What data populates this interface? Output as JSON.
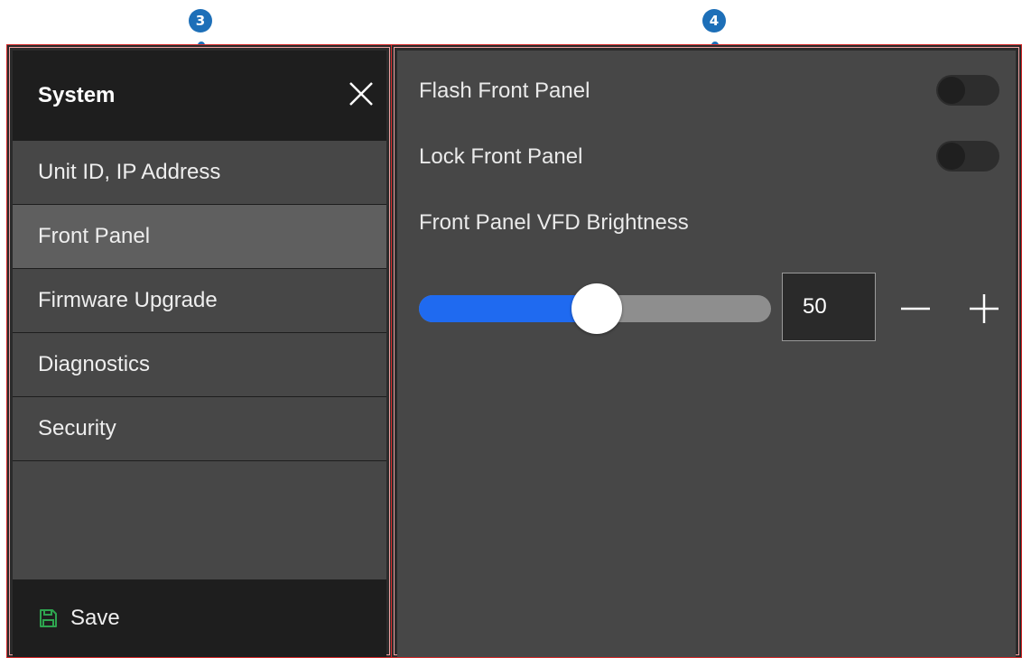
{
  "callouts": {
    "left": "3",
    "right": "4"
  },
  "sidebar": {
    "title": "System",
    "items": [
      {
        "label": "Unit ID, IP Address"
      },
      {
        "label": "Front Panel",
        "active": true
      },
      {
        "label": "Firmware Upgrade"
      },
      {
        "label": "Diagnostics"
      },
      {
        "label": "Security"
      }
    ],
    "save_label": "Save"
  },
  "content": {
    "flash_front_panel": {
      "label": "Flash Front Panel",
      "on": false
    },
    "lock_front_panel": {
      "label": "Lock Front Panel",
      "on": false
    },
    "brightness": {
      "label": "Front Panel VFD Brightness",
      "value": "50",
      "min": 0,
      "max": 100
    }
  },
  "colors": {
    "callout": "#1d6fb8",
    "accent": "#1f6af0",
    "save_icon": "#2ea44f",
    "highlight_frame": "#d62b2b"
  },
  "icons": [
    "close-icon",
    "save-icon",
    "minus-icon",
    "plus-icon"
  ]
}
